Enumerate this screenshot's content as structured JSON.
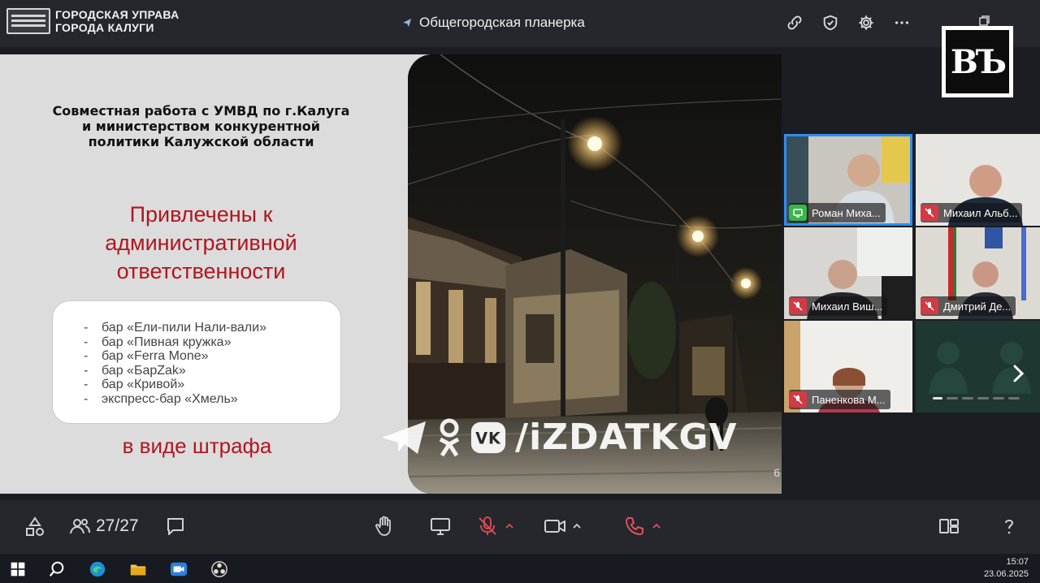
{
  "app": {
    "org_line1": "ГОРОДСКАЯ УПРАВА",
    "org_line2": "ГОРОДА КАЛУГИ",
    "meeting_title": "Общегородская планерка"
  },
  "brand_badge": "ВЪ",
  "slide": {
    "heading": "Совместная работа с УМВД по г.Калуга и министерством конкурентной политики Калужской области",
    "subtitle": "Привлечены к административной ответственности",
    "items": [
      "бар «Ели-пили Нали-вали»",
      "бар «Пивная кружка»",
      "бар «Ferra Mone»",
      "бар «БарZak»",
      "бар «Кривой»",
      "экспресс-бар «Хмель»"
    ],
    "footer": "в виде штрафа",
    "page_number": "6"
  },
  "watermark": "/iZDATKGV",
  "participants": [
    {
      "name": "Роман Миха...",
      "mic": "on",
      "active": true
    },
    {
      "name": "Михаил Альб...",
      "mic": "muted",
      "active": false
    },
    {
      "name": "Михаил Виш...",
      "mic": "muted",
      "active": false
    },
    {
      "name": "Дмитрий Де...",
      "mic": "muted",
      "active": false
    },
    {
      "name": "Паненкова М...",
      "mic": "muted",
      "active": false
    }
  ],
  "toolbar": {
    "participants_count": "27/27"
  },
  "taskbar": {
    "time": "15:07",
    "date": "23.06.2025"
  },
  "colors": {
    "accent_red": "#b01620",
    "active_blue": "#2f8df0",
    "mic_muted": "#d33a44",
    "mic_on": "#39b54a"
  }
}
